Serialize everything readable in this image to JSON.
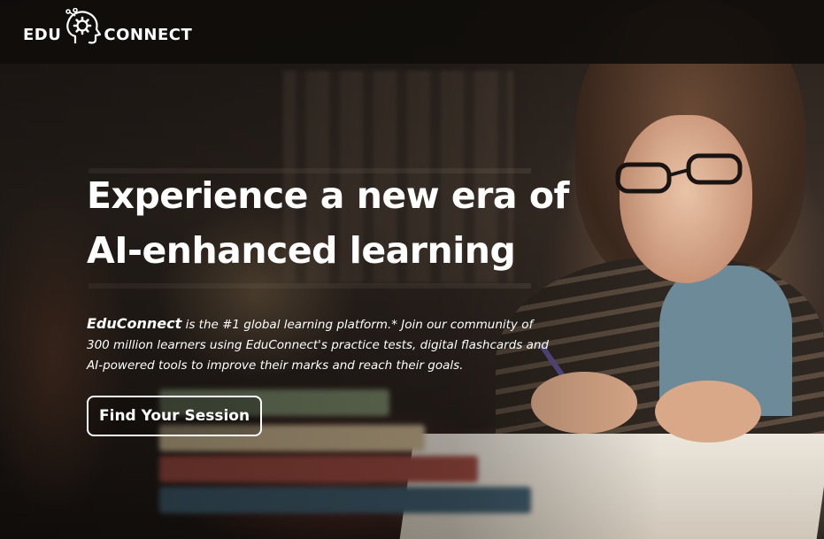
{
  "header": {
    "logo_left": "EDU",
    "logo_right": "CONNECT",
    "logo_icon": "brain-gear-icon"
  },
  "hero": {
    "headline": "Experience a new era of\nAI-enhanced learning",
    "brand_name": "EduConnect",
    "description": " is the #1 global learning platform.* Join our community of 300 million learners using EduConnect's practice tests, digital flashcards and AI-powered tools to improve their marks and reach their goals.",
    "cta_label": "Find Your Session",
    "background_image": "student-studying-photo"
  },
  "colors": {
    "header_bg": "#0f0c0a",
    "text": "#ffffff",
    "button_border": "#ffffff"
  }
}
